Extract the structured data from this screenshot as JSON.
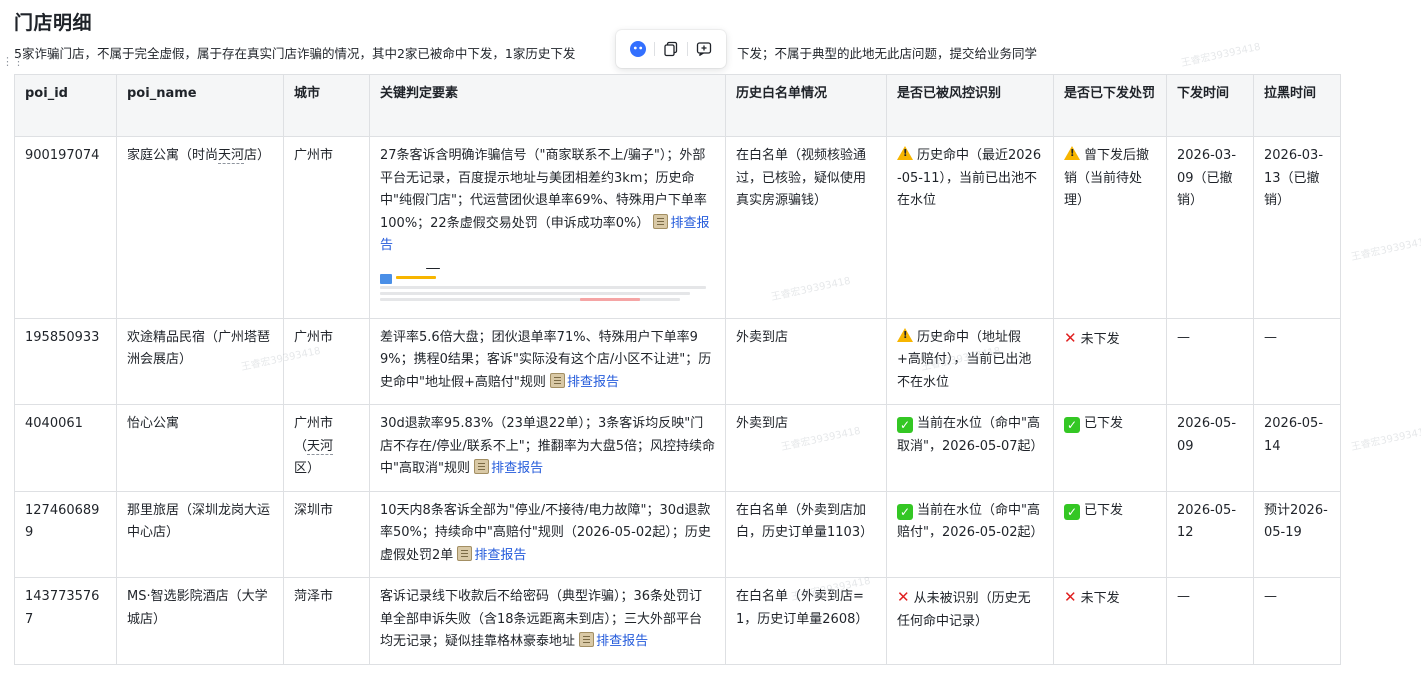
{
  "page": {
    "title": "门店明细",
    "summary_left": "5家诈骗门店，不属于完全虚假，属于存在真实门店诈骗的情况，其中2家已被命中下发，1家历史下发",
    "summary_right": "下发；不属于典型的此地无此店问题，提交给业务同学"
  },
  "toolbar": {
    "icons": [
      "assistant-icon",
      "copy-icon",
      "comment-icon"
    ]
  },
  "table": {
    "headers": [
      "poi_id",
      "poi_name",
      "城市",
      "关键判定要素",
      "历史白名单情况",
      "是否已被风控识别",
      "是否已下发处罚",
      "下发时间",
      "拉黑时间"
    ],
    "rows": [
      {
        "poi_id": "900197074",
        "poi_name_pre": "家庭公寓（时尚",
        "poi_name_underlined": "天河",
        "poi_name_post": "店）",
        "city": "广州市",
        "key_factors": "27条客诉含明确诈骗信号（\"商家联系不上/骗子\"）；外部平台无记录，百度提示地址与美团相差约3km；历史命中\"纯假门店\"；代运营团伙退单率69%、特殊用户下单率100%；22条虚假交易处罚（申诉成功率0%）",
        "report_link": "排查报告",
        "whitelist": "在白名单（视频核验通过，已核验，疑似使用真实房源骗钱）",
        "risk_status_icon": "warning",
        "risk_status": "历史命中（最近2026-05-11），当前已出池不在水位",
        "penalty_icon": "warning",
        "penalty": "曾下发后撤销（当前待处理）",
        "issue_time": "2026-03-09（已撤销）",
        "block_time": "2026-03-13（已撤销）"
      },
      {
        "poi_id": "195850933",
        "poi_name_pre": "欢途精品民宿（广州塔琶洲会展店）",
        "poi_name_underlined": "",
        "poi_name_post": "",
        "city": "广州市",
        "key_factors": "差评率5.6倍大盘；团伙退单率71%、特殊用户下单率99%；携程0结果；客诉\"实际没有这个店/小区不让进\"；历史命中\"地址假+高赔付\"规则",
        "report_link": "排查报告",
        "whitelist": "外卖到店",
        "risk_status_icon": "warning",
        "risk_status": "历史命中（地址假+高赔付），当前已出池不在水位",
        "penalty_icon": "cross",
        "penalty": "未下发",
        "issue_time": "—",
        "block_time": "—"
      },
      {
        "poi_id": "4040061",
        "poi_name_pre": "怡心公寓",
        "poi_name_underlined": "",
        "poi_name_post": "",
        "city_pre": "广州市（",
        "city_underlined": "天河",
        "city_post": "区）",
        "key_factors": "30d退款率95.83%（23单退22单）；3条客诉均反映\"门店不存在/停业/联系不上\"；推翻率为大盘5倍；风控持续命中\"高取消\"规则",
        "report_link": "排查报告",
        "whitelist": "外卖到店",
        "risk_status_icon": "check",
        "risk_status": "当前在水位（命中\"高取消\"，2026-05-07起）",
        "penalty_icon": "check",
        "penalty": "已下发",
        "issue_time": "2026-05-09",
        "block_time": "2026-05-14"
      },
      {
        "poi_id": "1274606899",
        "poi_name_pre": "那里旅居（深圳龙岗大运中心店）",
        "poi_name_underlined": "",
        "poi_name_post": "",
        "city": "深圳市",
        "key_factors": "10天内8条客诉全部为\"停业/不接待/电力故障\"；30d退款率50%；持续命中\"高赔付\"规则（2026-05-02起）；历史虚假处罚2单",
        "report_link": "排查报告",
        "whitelist": "在白名单（外卖到店加白，历史订单量1103）",
        "risk_status_icon": "check",
        "risk_status": "当前在水位（命中\"高赔付\"，2026-05-02起）",
        "penalty_icon": "check",
        "penalty": "已下发",
        "issue_time": "2026-05-12",
        "block_time": "预计2026-05-19"
      },
      {
        "poi_id": "1437735767",
        "poi_name_pre": "MS·智选影院酒店（大学城店）",
        "poi_name_underlined": "",
        "poi_name_post": "",
        "city": "菏泽市",
        "key_factors": "客诉记录线下收款后不给密码（典型诈骗）；36条处罚订单全部申诉失败（含18条远距离未到店）；三大外部平台均无记录；疑似挂靠格林豪泰地址",
        "report_link": "排查报告",
        "whitelist": "在白名单（外卖到店=1，历史订单量2608）",
        "risk_status_icon": "cross",
        "risk_status": "从未被识别（历史无任何命中记录）",
        "penalty_icon": "cross",
        "penalty": "未下发",
        "issue_time": "—",
        "block_time": "—"
      }
    ]
  },
  "watermark_text": "王睿宏39393418"
}
